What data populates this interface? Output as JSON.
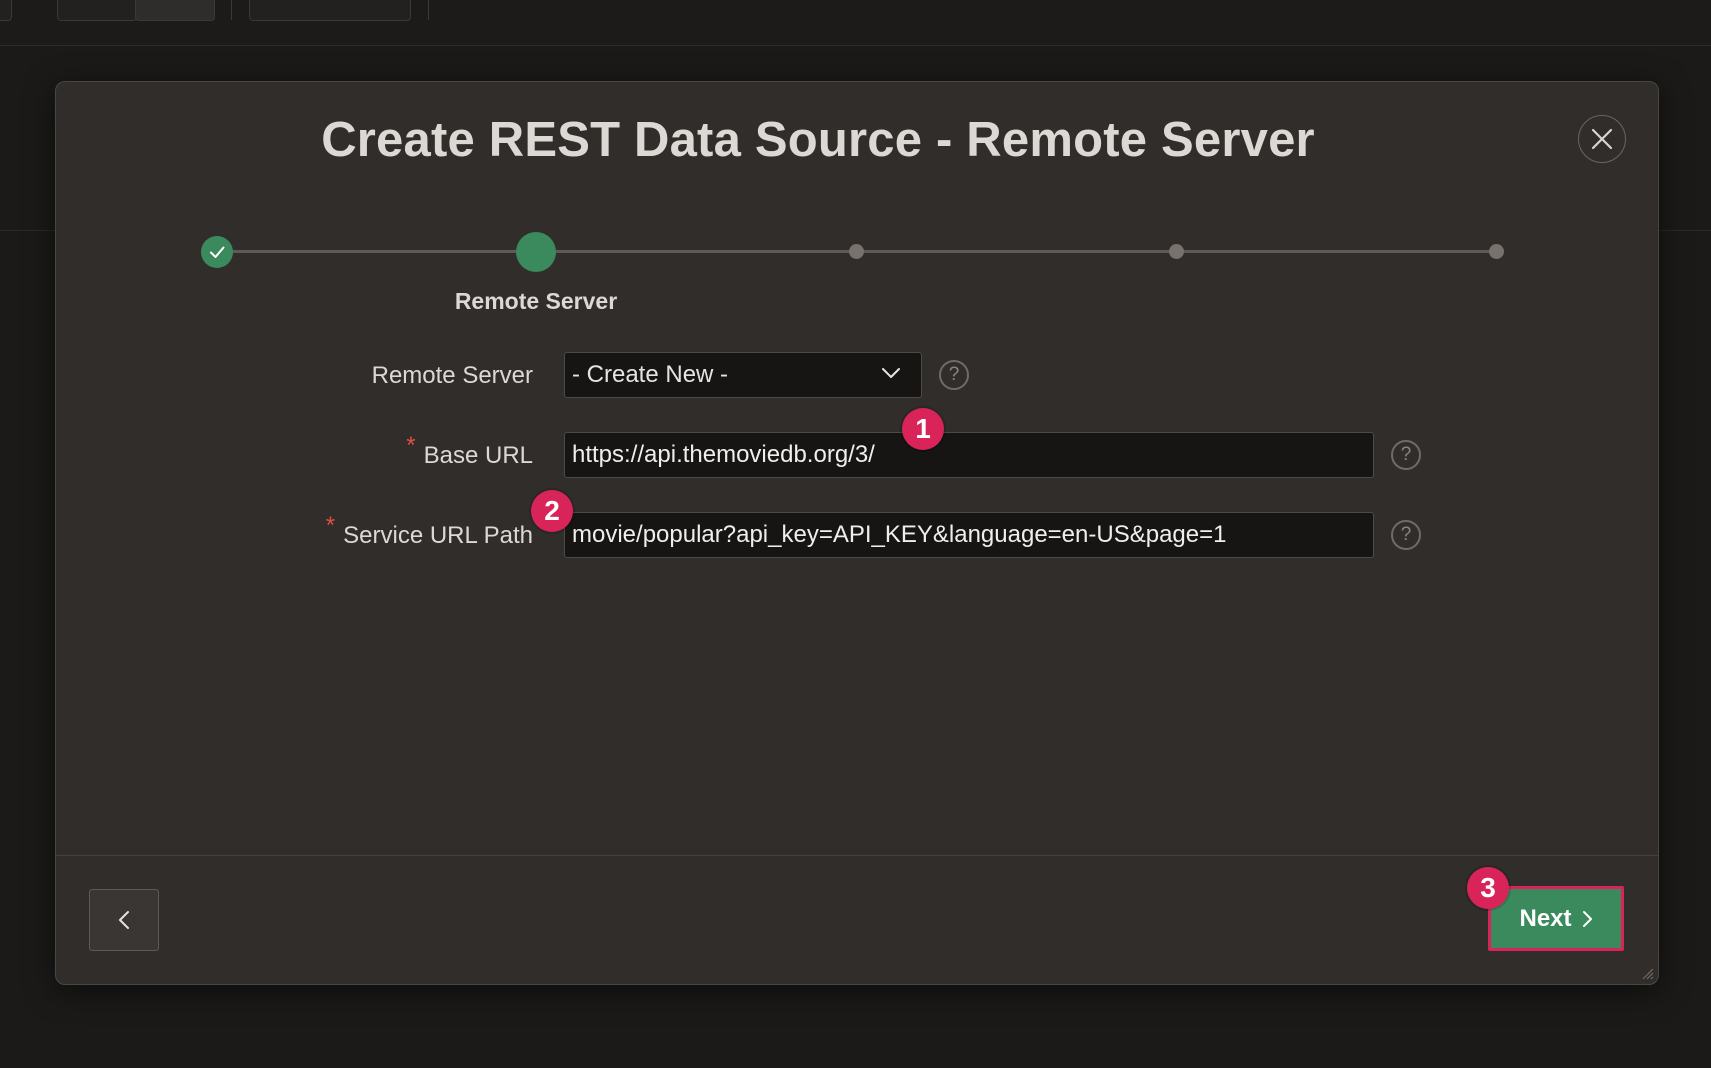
{
  "dialog": {
    "title": "Create REST Data Source - Remote Server",
    "close_icon": "close-icon"
  },
  "wizard": {
    "total_steps": 5,
    "completed_steps": 1,
    "current_step": 2,
    "current_step_label": "Remote Server"
  },
  "form": {
    "remote_server": {
      "label": "Remote Server",
      "value": "- Create New -"
    },
    "base_url": {
      "label": "Base URL",
      "required_marker": "*",
      "value": "https://api.themoviedb.org/3/"
    },
    "service_url_path": {
      "label": "Service URL Path",
      "required_marker": "*",
      "value": "movie/popular?api_key=API_KEY&language=en-US&page=1"
    },
    "help_glyph": "?"
  },
  "annotations": [
    "1",
    "2",
    "3"
  ],
  "footer": {
    "next_label": "Next"
  },
  "colors": {
    "accent_green": "#3b8a5d",
    "badge_pink": "#d9245a",
    "required_red": "#e0503f"
  }
}
